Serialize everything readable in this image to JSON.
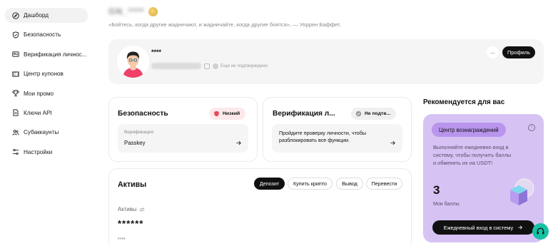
{
  "sidebar": {
    "items": [
      {
        "label": "Дашборд",
        "icon": "compass-icon",
        "active": true
      },
      {
        "label": "Безопасность",
        "icon": "shield-icon"
      },
      {
        "label": "Верификация личнос...",
        "icon": "id-card-icon"
      },
      {
        "label": "Центр купонов",
        "icon": "coupon-icon"
      },
      {
        "label": "Мои промо",
        "icon": "trophy-icon"
      },
      {
        "label": "Ключи API",
        "icon": "document-icon"
      },
      {
        "label": "Субаккаунты",
        "icon": "users-icon"
      },
      {
        "label": "Настройки",
        "icon": "sliders-icon"
      }
    ]
  },
  "header": {
    "username_masked": "GN_****",
    "quote": "«Бойтесь, когда другие жадничают, и жадничайте, когда другие боятся», — Уоррен Баффет."
  },
  "profile": {
    "nickname": "****",
    "verification_status": "Еще не подтверждено",
    "more_label": "...",
    "profile_button": "Профиль"
  },
  "security": {
    "title": "Безопасность",
    "level_badge": "Низкий",
    "method_caption": "Верификация",
    "method_value": "Passkey"
  },
  "verification": {
    "title": "Верификация л...",
    "status_badge": "Не подтв...",
    "description": "Пройдите проверку личности, чтобы разблокировать все функции."
  },
  "assets": {
    "title": "Активы",
    "tabs": [
      "Депозит",
      "Купить крипто",
      "Вывод",
      "Перевести"
    ],
    "balance_label": "Активы",
    "balance_masked": "******",
    "sub_masked": "****"
  },
  "recommendation": {
    "section_title": "Рекомендуется для вас",
    "badge": "Центр вознаграждений",
    "info_glyph": "!",
    "text": "Выполняйте ежедневно вход в систему, чтобы получить баллы и обменять их на USDT!",
    "points_value": "3",
    "points_label": "Мои баллы",
    "cta": "Ежедневный вход в систему"
  },
  "colors": {
    "accent_purple": "#d7c3f3",
    "badge_purple": "#b995ed",
    "danger_pill": "#fde9ea",
    "support_green": "#16c2a3"
  }
}
